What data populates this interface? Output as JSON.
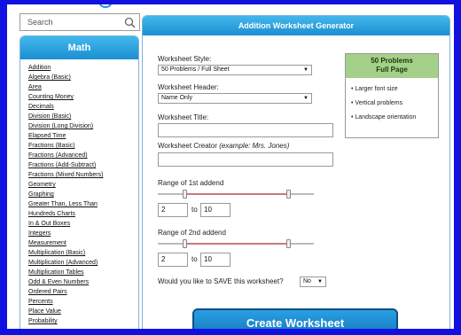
{
  "search": {
    "placeholder": "Search"
  },
  "sidebar": {
    "title": "Math",
    "items": [
      "Addition",
      "Algebra (Basic)",
      "Area",
      "Counting Money",
      "Decimals",
      "Division (Basic)",
      "Division (Long Division)",
      "Elapsed Time",
      "Fractions (Basic)",
      "Fractions (Advanced)",
      "Fractions (Add-Subtract)",
      "Fractions (Mixed Numbers)",
      "Geometry",
      "Graphing",
      "Greater Than, Less Than",
      "Hundreds Charts",
      "In & Out Boxes",
      "Integers",
      "Measurement",
      "Multiplication (Basic)",
      "Multiplication (Advanced)",
      "Multiplication Tables",
      "Odd & Even Numbers",
      "Ordered Pairs",
      "Percents",
      "Place Value",
      "Probability"
    ]
  },
  "panel": {
    "title": "Addition Worksheet Generator",
    "style_label": "Worksheet Style:",
    "style_value": "50 Problems / Full Sheet",
    "header_label": "Worksheet Header:",
    "header_value": "Name Only",
    "title_label": "Worksheet Title:",
    "title_value": "",
    "creator_label": "Worksheet Creator",
    "creator_hint": "(example: Mrs. Jones)",
    "creator_value": "",
    "range1_label": "Range of 1st addend",
    "range1_min": "2",
    "range1_max": "10",
    "range2_label": "Range of 2nd addend",
    "range2_min": "2",
    "range2_max": "10",
    "to_label": "to",
    "save_label": "Would you like to SAVE this worksheet?",
    "save_value": "No",
    "create_label": "Create Worksheet"
  },
  "info": {
    "title_line1": "50 Problems",
    "title_line2": "Full Page",
    "bullets": [
      "Larger font size",
      "Vertical problems",
      "Landscape orientation"
    ]
  },
  "colors": {
    "border": "#1010e0",
    "header_blue": "#1b8fd0",
    "info_green": "#a4d08a",
    "slider_fill": "#c47a7a"
  }
}
